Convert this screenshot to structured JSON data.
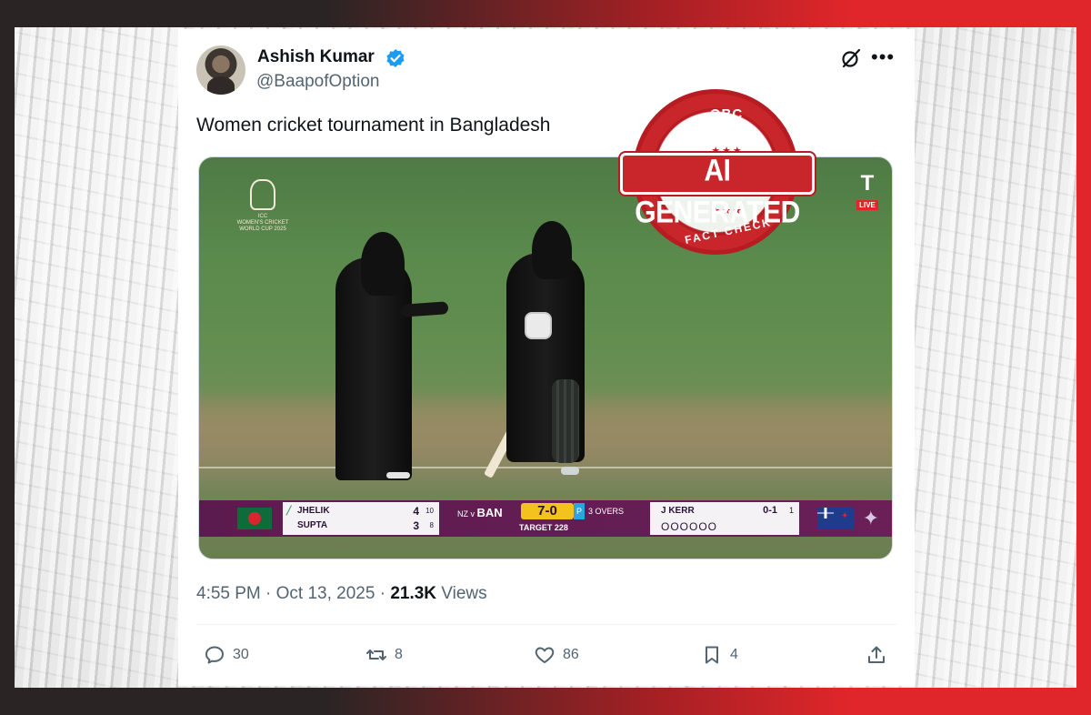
{
  "tweet": {
    "author": {
      "display_name": "Ashish Kumar",
      "handle": "@BaapofOption",
      "verified": true
    },
    "text": "Women cricket tournament in Bangladesh",
    "timestamp": "4:55 PM · Oct 13, 2025 · ",
    "views_count": "21.3K",
    "views_label": " Views",
    "actions": {
      "reply_count": "30",
      "retweet_count": "8",
      "like_count": "86",
      "bookmark_count": "4"
    }
  },
  "media": {
    "event_logo_text": "WOMEN'S CRICKET WORLD CUP 2025",
    "event_logo_top": "ICC",
    "broadcaster_mark": "T",
    "live_label": "LIVE",
    "scorebar": {
      "batter1_name": "JHELIK",
      "batter1_runs": "4",
      "batter1_balls": "10",
      "batter2_name": "SUPTA",
      "batter2_runs": "3",
      "batter2_balls": "8",
      "match_small": "NZ v ",
      "match_big": "BAN",
      "score": "7-0",
      "powerplay": "P",
      "overs": "3 OVERS",
      "target": "TARGET 228",
      "bowler_name": "J KERR",
      "bowler_figures": "0-1",
      "bowler_overs": "1",
      "balls_this_over": "OOOOOO"
    }
  },
  "stamp": {
    "brand": "OBC",
    "label": "AI GENERATED",
    "sublabel": "FACT CHECK",
    "stars": "★★★",
    "color": "#c8262b"
  },
  "icons": [
    "verified-badge-icon",
    "grok-icon",
    "more-icon",
    "reply-icon",
    "retweet-icon",
    "like-icon",
    "bookmark-icon",
    "share-icon"
  ],
  "colors": {
    "verified": "#1d9bf0",
    "text_primary": "#0f1419",
    "text_secondary": "#536471"
  }
}
